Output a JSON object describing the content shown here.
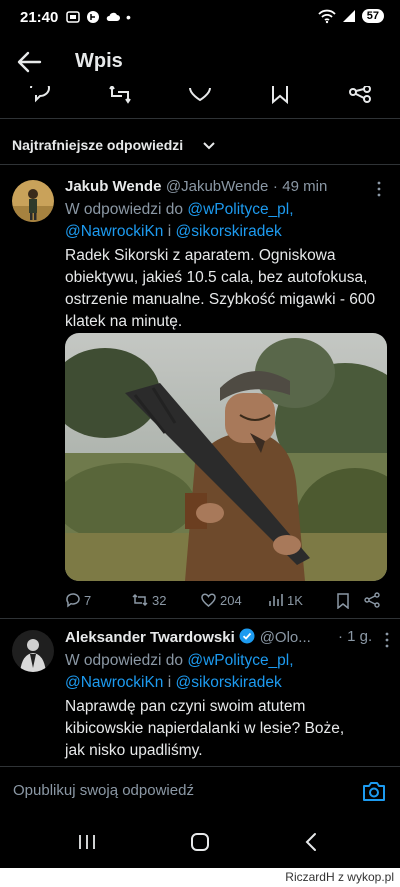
{
  "status_bar": {
    "time": "21:40",
    "battery": "57",
    "dot": "•"
  },
  "header": {
    "title": "Wpis"
  },
  "sort": {
    "label": "Najtrafniejsze odpowiedzi"
  },
  "replies": [
    {
      "name": "Jakub Wende",
      "handle": "@JakubWende",
      "sep": "·",
      "time": "49 min",
      "reply_prefix": "W odpowiedzi do",
      "mention1": "@wPolityce_pl,",
      "mention2": "@NawrockiKn",
      "conj": "i",
      "mention3": "@sikorskiradek",
      "text": "Radek Sikorski z aparatem. Ogniskowa obiektywu, jakieś 10.5 cala, bez autofokusa, ostrzenie manualne. Szybkość migawki - 600 klatek na minutę.",
      "stats": {
        "replies": "7",
        "reposts": "32",
        "likes": "204",
        "views": "1K"
      }
    },
    {
      "name": "Aleksander Twardowski",
      "handle": "@Olo...",
      "sep": "·",
      "time": "1 g.",
      "reply_prefix": "W odpowiedzi do",
      "mention1": "@wPolityce_pl,",
      "mention2": "@NawrockiKn",
      "conj": "i",
      "mention3": "@sikorskiradek",
      "text": "Naprawdę pan czyni swoim atutem kibicowskie napierdalanki w lesie? Boże, jak nisko upadliśmy."
    }
  ],
  "compose": {
    "placeholder": "Opublikuj swoją odpowiedź"
  },
  "watermark": {
    "text": "RiczardH z wykop.pl"
  },
  "colors": {
    "link": "#1d9bf0",
    "muted": "#8b98a5",
    "verified": "#1d9bf0"
  }
}
